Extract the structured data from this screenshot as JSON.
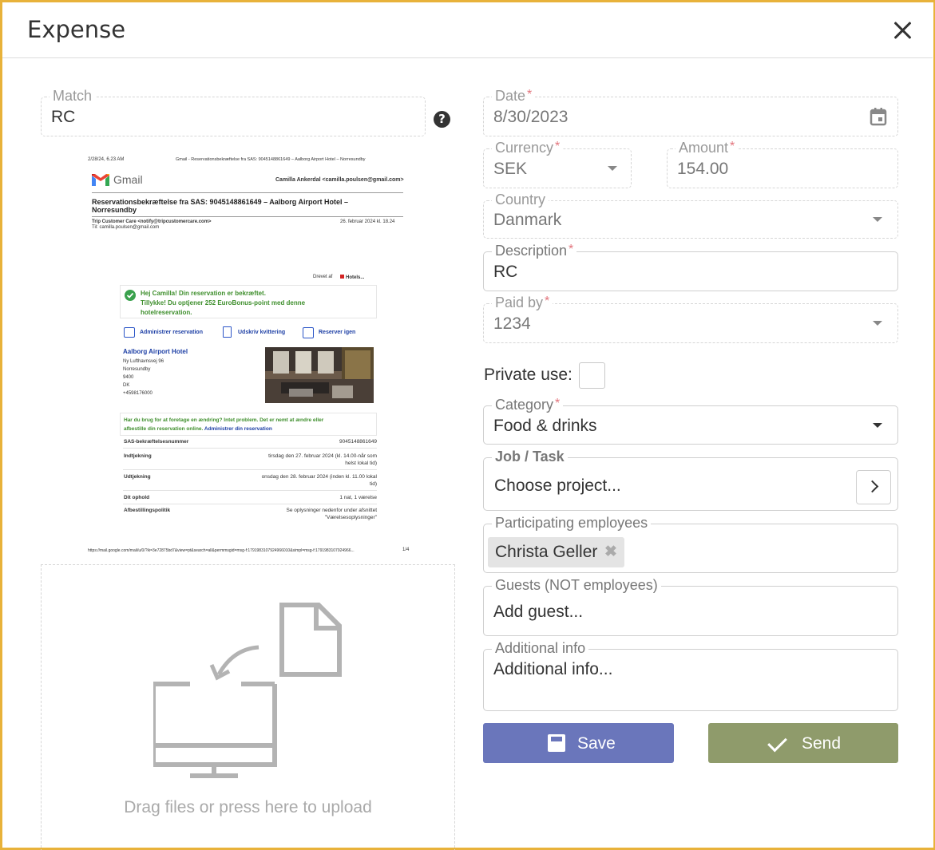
{
  "dialog": {
    "title": "Expense"
  },
  "match": {
    "label": "Match",
    "value": "RC"
  },
  "date": {
    "label": "Date",
    "required": "*",
    "value": "8/30/2023"
  },
  "currency": {
    "label": "Currency",
    "required": "*",
    "value": "SEK"
  },
  "amount": {
    "label": "Amount",
    "required": "*",
    "value": "154.00"
  },
  "country": {
    "label": "Country",
    "value": "Danmark"
  },
  "description": {
    "label": "Description",
    "required": "*",
    "value": "RC"
  },
  "paid_by": {
    "label": "Paid by",
    "required": "*",
    "value": "1234"
  },
  "private_use": {
    "label": "Private use:",
    "checked": false
  },
  "category": {
    "label": "Category",
    "required": "*",
    "value": "Food & drinks"
  },
  "job": {
    "label": "Job / Task",
    "placeholder": "Choose project..."
  },
  "participants": {
    "label": "Participating employees",
    "chips": [
      "Christa Geller"
    ]
  },
  "guests": {
    "label": "Guests (NOT employees)",
    "placeholder": "Add guest..."
  },
  "additional": {
    "label": "Additional info",
    "placeholder": "Additional info..."
  },
  "buttons": {
    "save": "Save",
    "send": "Send"
  },
  "upload": {
    "text": "Drag files or press here to upload"
  },
  "colors": {
    "accent_border": "#e8b23a",
    "save": "#6a76bb",
    "send": "#8f9b6b"
  },
  "receipt": {
    "top_left": "2/28/24, 6.23 AM",
    "top_center": "Gmail - Reservationsbekræftelse fra SAS: 9045148861649 – Aalborg Airport Hotel – Norresundby",
    "gmail": "Gmail",
    "account": "Camilla Ankerdal <camilla.poulsen@gmail.com>",
    "subject_1": "Reservationsbekræftelse fra SAS: 9045148861649 – Aalborg Airport Hotel –",
    "subject_2": "Norresundby",
    "from": "Trip Customer Care <notify@tripcustomercare.com>",
    "date": "26. februar 2024 kl. 18.24",
    "to": "Til: camilla.poulsen@gmail.com",
    "powered": "Drevet af",
    "brand": "Hotels...",
    "greet_1": "Hej Camilla! Din reservation er bekræftet.",
    "greet_2": "Tillykke! Du optjener 252 EuroBonus-point med denne",
    "greet_3": "hotelreservation.",
    "link_manage": "Administrer reservation",
    "link_print": "Udskriv kvittering",
    "link_rebook": "Reserver igen",
    "hotel_name": "Aalborg Airport Hotel",
    "addr_1": "Ny Lufthavnsvej 96",
    "addr_2": "Norresundby",
    "addr_3": "9400",
    "addr_4": "DK",
    "addr_5": "+4598176000",
    "notice_1": "Har du brug for at foretage en ændring? Intet problem. Det er nemt at ændre eller",
    "notice_2": "afbestille din reservation online.",
    "notice_link": "Administrer din reservation",
    "rows": [
      {
        "k": "SAS-bekræftelsesnummer",
        "v1": "9045148861649",
        "v2": ""
      },
      {
        "k": "Indtjekning",
        "v1": "tirsdag den 27. februar 2024 (kl. 14.00-når som",
        "v2": "helst lokal tid)"
      },
      {
        "k": "Udtjekning",
        "v1": "onsdag den 28. februar 2024 (inden kl. 11.00 lokal",
        "v2": "tid)"
      },
      {
        "k": "Dit ophold",
        "v1": "1 nat, 1 værelse",
        "v2": ""
      },
      {
        "k": "Afbestillingspolitik",
        "v1": "Se oplysninger nedenfor under afsnittet",
        "v2": "\"Værelsesoplysninger\""
      }
    ],
    "footer_url": "https://mail.google.com/mail/u/0/?ik=3e72875bd7&view=pt&search=all&permmsgid=msg-f:1791983107924966010&simpl=msg-f:1791983107924966...",
    "footer_page": "1/4"
  }
}
